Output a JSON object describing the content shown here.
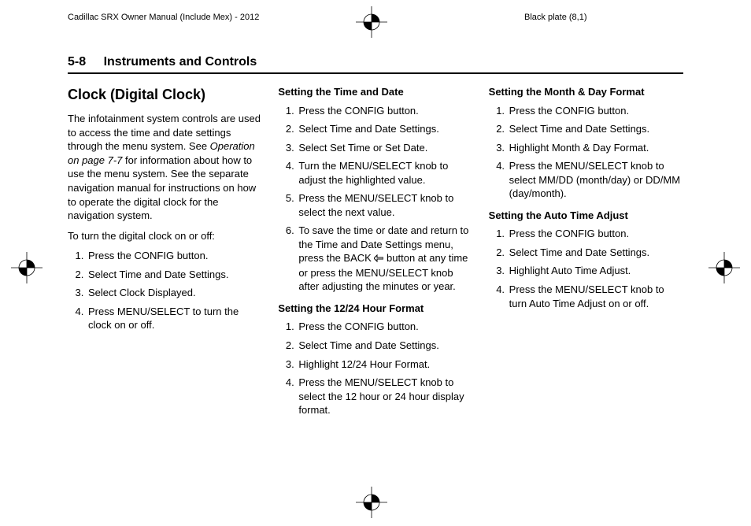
{
  "header": {
    "doc_title": "Cadillac SRX Owner Manual (Include Mex) - 2012",
    "plate_label": "Black plate (8,1)",
    "section_number": "5-8",
    "section_title": "Instruments and Controls"
  },
  "col1": {
    "heading": "Clock (Digital Clock)",
    "intro_part1": "The infotainment system controls are used to access the time and date settings through the menu system. See ",
    "intro_italic": "Operation on page 7-7",
    "intro_part2": " for information about how to use the menu system. See the separate navigation manual for instructions on how to operate the digital clock for the navigation system.",
    "toggle_lead": "To turn the digital clock on or off:",
    "toggle_steps": [
      "Press the CONFIG button.",
      "Select Time and Date Settings.",
      "Select Clock Displayed.",
      "Press MENU/SELECT to turn the clock on or off."
    ]
  },
  "col2": {
    "h_time_date": "Setting the Time and Date",
    "time_date_steps": [
      "Press the CONFIG button.",
      "Select Time and Date Settings.",
      "Select Set Time or Set Date.",
      "Turn the MENU/SELECT knob to adjust the highlighted value.",
      "Press the MENU/SELECT knob to select the next value."
    ],
    "time_date_step6_a": "To save the time or date and return to the Time and Date Settings menu, press the BACK ",
    "time_date_step6_b": " button at any time or press the MENU/SELECT knob after adjusting the minutes or year.",
    "h_12_24": "Setting the 12/24 Hour Format",
    "hr_steps": [
      "Press the CONFIG button.",
      "Select Time and Date Settings.",
      "Highlight 12/24 Hour Format.",
      "Press the MENU/SELECT knob to select the 12 hour or 24 hour display format."
    ]
  },
  "col3": {
    "h_month_day": "Setting the Month & Day Format",
    "md_steps": [
      "Press the CONFIG button.",
      "Select Time and Date Settings.",
      "Highlight Month & Day Format.",
      "Press the MENU/SELECT knob to select MM/DD (month/day) or DD/MM (day/month)."
    ],
    "h_auto": "Setting the Auto Time Adjust",
    "auto_steps": [
      "Press the CONFIG button.",
      "Select Time and Date Settings.",
      "Highlight Auto Time Adjust.",
      "Press the MENU/SELECT knob to turn Auto Time Adjust on or off."
    ]
  },
  "icons": {
    "back_arrow_name": "back-arrow-icon"
  }
}
